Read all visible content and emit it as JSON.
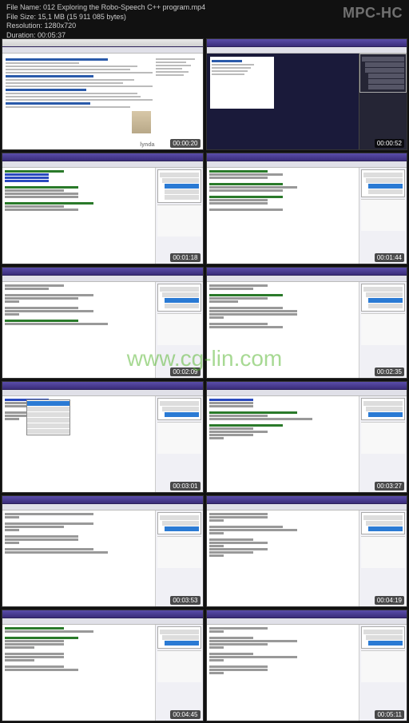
{
  "header": {
    "file_name_label": "File Name:",
    "file_name": "012 Exploring the Robo-Speech C++ program.mp4",
    "file_size_label": "File Size:",
    "file_size": "15,1 MB (15 911 085 bytes)",
    "resolution_label": "Resolution:",
    "resolution": "1280x720",
    "duration_label": "Duration:",
    "duration": "00:05:37",
    "app_name": "MPC-HC"
  },
  "thumbs": [
    {
      "timestamp": "00:00:20",
      "type": "browser",
      "lynda": "lynda"
    },
    {
      "timestamp": "00:00:52",
      "type": "dark"
    },
    {
      "timestamp": "00:01:18",
      "type": "code"
    },
    {
      "timestamp": "00:01:44",
      "type": "code"
    },
    {
      "timestamp": "00:02:09",
      "type": "code"
    },
    {
      "timestamp": "00:02:35",
      "type": "code"
    },
    {
      "timestamp": "00:03:01",
      "type": "code-menu"
    },
    {
      "timestamp": "00:03:27",
      "type": "code"
    },
    {
      "timestamp": "00:03:53",
      "type": "code"
    },
    {
      "timestamp": "00:04:19",
      "type": "code"
    },
    {
      "timestamp": "00:04:45",
      "type": "code"
    },
    {
      "timestamp": "00:05:11",
      "type": "code"
    }
  ],
  "watermark": "www.cg-lin.com"
}
